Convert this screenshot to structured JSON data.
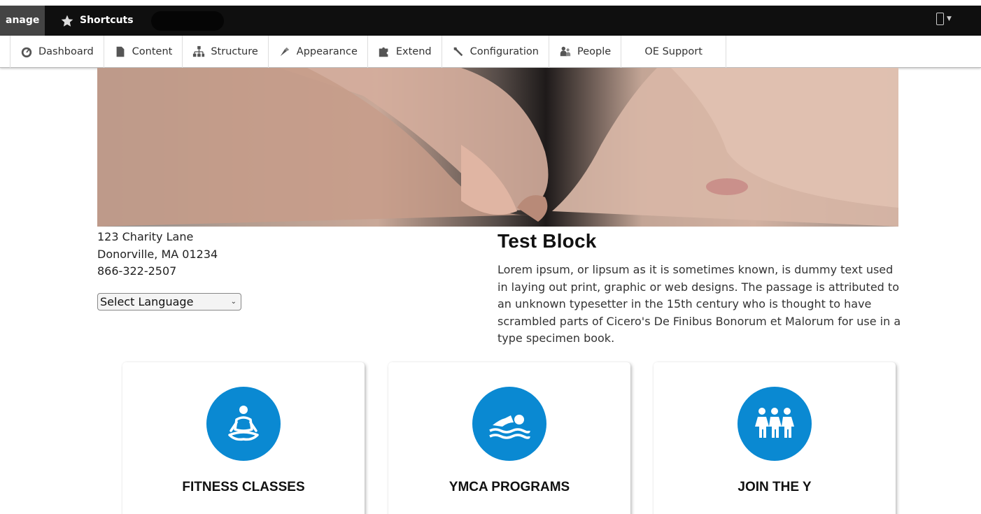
{
  "toolbar": {
    "manage_label": "anage",
    "shortcuts_label": "Shortcuts"
  },
  "tray": {
    "items": [
      {
        "label": "Dashboard",
        "icon": "dashboard-icon"
      },
      {
        "label": "Content",
        "icon": "content-icon"
      },
      {
        "label": "Structure",
        "icon": "structure-icon"
      },
      {
        "label": "Appearance",
        "icon": "appearance-icon"
      },
      {
        "label": "Extend",
        "icon": "extend-icon"
      },
      {
        "label": "Configuration",
        "icon": "configuration-icon"
      },
      {
        "label": "People",
        "icon": "people-icon"
      }
    ],
    "support_label": "OE Support"
  },
  "address": {
    "line1": "123 Charity Lane",
    "line2": "Donorville, MA 01234",
    "phone": "866-322-2507"
  },
  "language": {
    "selected": "Select Language"
  },
  "block": {
    "title": "Test Block",
    "body": "Lorem ipsum, or lipsum as it is sometimes known, is dummy text used in laying out print, graphic or web designs. The passage is attributed to an unknown typesetter in the 15th century who is thought to have scrambled parts of Cicero's De Finibus Bonorum et Malorum for use in a type specimen book."
  },
  "cards": [
    {
      "label": "FITNESS CLASSES",
      "icon": "meditation-icon"
    },
    {
      "label": "YMCA PROGRAMS",
      "icon": "swimmer-icon"
    },
    {
      "label": "JOIN THE Y",
      "icon": "people-group-icon"
    }
  ],
  "colors": {
    "toolbar_bg": "#0f0f0f",
    "icon_circle": "#0a89d2"
  }
}
